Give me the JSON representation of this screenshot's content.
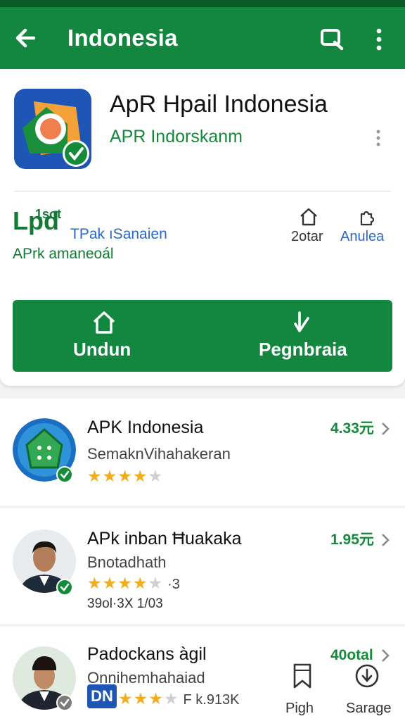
{
  "appbar": {
    "title": "Indonesia",
    "back_icon": "arrow-left-icon",
    "search_icon": "search-icon",
    "menu_icon": "more-vert-icon"
  },
  "app": {
    "title": "ApR Hpail Indonesia",
    "developer": "APR Indorskanm",
    "stat_big": "Lpd",
    "stat_sup": "1sot",
    "stat_sub": "TPak ıSanaien",
    "stat_line": "APrk amaneoál",
    "mini1_label": "2otar",
    "mini2_label": "Anulea"
  },
  "actions": {
    "primary_label": "Undun",
    "secondary_label": "Pegnbraia"
  },
  "list": [
    {
      "title": "APK Indonesia",
      "subtitle": "SemaknVihahakeran",
      "value": "4.33元",
      "rating": 4
    },
    {
      "title": "APk inban Ħuakaka",
      "subtitle": "Bnotadhath",
      "value": "1.95元",
      "rating": 4,
      "stars_suffix": "·3",
      "extra": "39ol·3X 1/03"
    },
    {
      "title": "Padockans àgil",
      "subtitle": "Onnihemhahaiad",
      "value": "40otal",
      "rating": 3,
      "stars_suffix": "F k.913K",
      "logo_text": "DN"
    }
  ],
  "bottom_actions": [
    {
      "label": "Pigh",
      "icon": "bookmark-icon"
    },
    {
      "label": "Sarage",
      "icon": "download-circle-icon"
    }
  ],
  "colors": {
    "primary": "#13873f",
    "accent_blue": "#2a68c9",
    "star": "#f0ad1e"
  }
}
